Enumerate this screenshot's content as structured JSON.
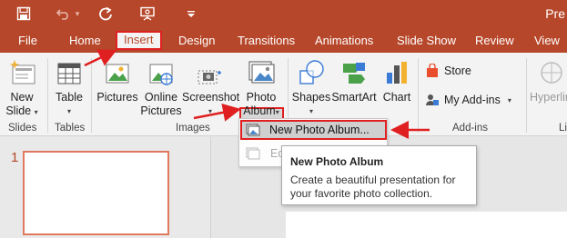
{
  "window": {
    "title_partial": "Pre"
  },
  "quick_access": {
    "save_icon": "save-icon",
    "undo_icon": "undo-icon",
    "redo_icon": "redo-icon",
    "present_icon": "present-from-start-icon",
    "customize_icon": "customize-qat-icon"
  },
  "tabs": [
    {
      "label": "File"
    },
    {
      "label": "Home"
    },
    {
      "label": "Insert"
    },
    {
      "label": "Design"
    },
    {
      "label": "Transitions"
    },
    {
      "label": "Animations"
    },
    {
      "label": "Slide Show"
    },
    {
      "label": "Review"
    },
    {
      "label": "View"
    }
  ],
  "ribbon": {
    "new_slide": {
      "line1": "New",
      "line2": "Slide"
    },
    "table": {
      "label": "Table"
    },
    "pictures": {
      "label": "Pictures"
    },
    "online_pictures": {
      "line1": "Online",
      "line2": "Pictures"
    },
    "screenshot": {
      "label": "Screenshot"
    },
    "photo_album": {
      "line1": "Photo",
      "line2": "Album"
    },
    "shapes": {
      "label": "Shapes"
    },
    "smartart": {
      "label": "SmartArt"
    },
    "chart": {
      "label": "Chart"
    },
    "store": {
      "label": "Store"
    },
    "my_addins": {
      "label": "My Add-ins"
    },
    "hyperlink": {
      "label": "Hyperlin"
    },
    "groups": {
      "slides": "Slides",
      "tables": "Tables",
      "images": "Images",
      "addins": "Add-ins",
      "links": "Li"
    }
  },
  "dropdown": {
    "item1": "New Photo Album...",
    "item2": "Ed"
  },
  "tooltip": {
    "title": "New Photo Album",
    "body_line1": "Create a beautiful presentation for",
    "body_line2": "your favorite photo collection."
  },
  "slides_pane": {
    "slide_number": "1"
  },
  "colors": {
    "accent": "#b7472a",
    "highlight_red": "#e02020"
  }
}
